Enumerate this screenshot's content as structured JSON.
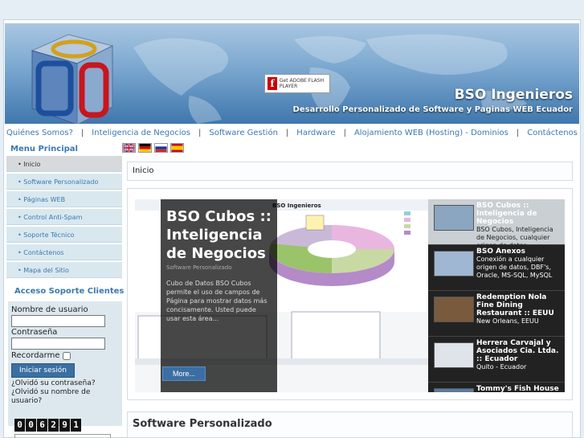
{
  "header": {
    "site_title": "BSO Ingenieros",
    "site_subtitle": "Desarrollo Personalizado de Software y Paginas WEB Ecuador",
    "flash_badge": "Get ADOBE FLASH PLAYER"
  },
  "topnav": [
    "Quiénes Somos?",
    "Inteligencia de Negocios",
    "Software Gestión",
    "Hardware",
    "Alojamiento WEB (Hosting) - Dominios",
    "Contáctenos"
  ],
  "sidebar": {
    "title": "Menu Principal",
    "items": [
      {
        "label": "Inicio"
      },
      {
        "label": "Software Personalizado"
      },
      {
        "label": "Páginas WEB"
      },
      {
        "label": "Control Anti-Spam"
      },
      {
        "label": "Soporte Técnico"
      },
      {
        "label": "Contáctenos"
      },
      {
        "label": "Mapa del Sitio"
      }
    ]
  },
  "login": {
    "title": "Acceso Soporte Clientes",
    "username_label": "Nombre de usuario",
    "password_label": "Contraseña",
    "remember_label": "Recordarme",
    "submit_label": "Iniciar sesión",
    "forgot_password": "¿Olvidó su contraseña?",
    "forgot_username": "¿Olvidó su nombre de usuario?"
  },
  "counter": [
    "0",
    "0",
    "6",
    "2",
    "9",
    "1"
  ],
  "breadcrumb": "Inicio",
  "slider": {
    "chart_title": "BSO Ingenieros",
    "headline": "BSO Cubos :: Inteligencia de Negocios",
    "category": "Software Personalizado",
    "description": "Cubo de Datos BSO Cubos permite el uso de campos de Página para mostrar datos más concisamente. Usted puede usar esta área...",
    "more_label": "More...",
    "thumbs": [
      {
        "title": "BSO Cubos :: Inteligencia de Negocios",
        "desc": "BSO Cubos, Inteligencia de Negocios, cualquier origen de datos"
      },
      {
        "title": "BSO Anexos",
        "desc": "Conexión a cualquier origen de datos, DBF's, Oracle, MS-SQL, MySQL"
      },
      {
        "title": "Redemption Nola Fine Dining Restaurant :: EEUU",
        "desc": "New Orleans, EEUU"
      },
      {
        "title": "Herrera Carvajal y Asociados Cia. Ltda. :: Ecuador",
        "desc": "Quito - Ecuador"
      },
      {
        "title": "Tommy's Fish House Restaurant",
        "desc": ""
      }
    ]
  },
  "section_title": "Software Personalizado",
  "colors": {
    "accent": "#3a79b1",
    "header_dark": "#3f77ad",
    "menu_bg": "#d9e8ef"
  }
}
